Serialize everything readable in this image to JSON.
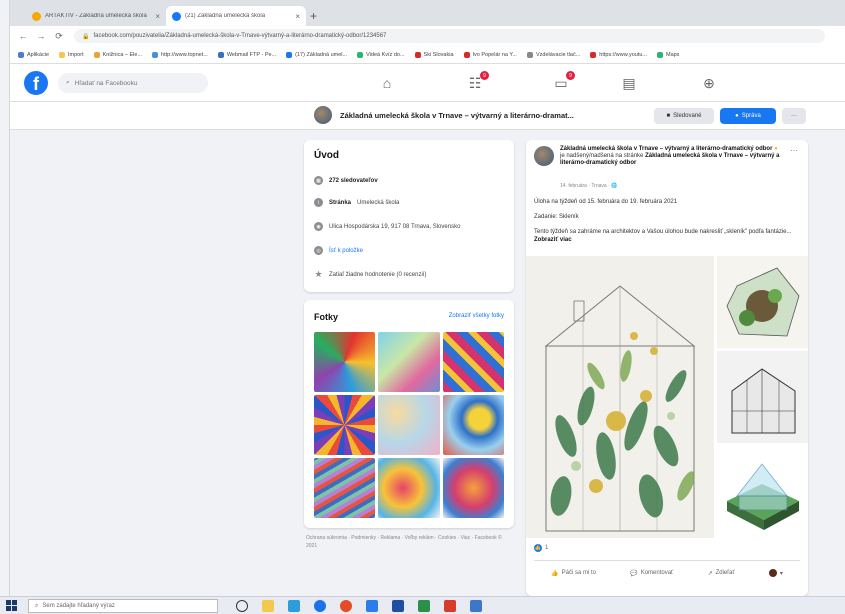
{
  "browser": {
    "tabs": [
      {
        "title": "ARTAKTÍV - Základná umelecká škola",
        "fav_color": "#f7a800"
      },
      {
        "title": "(21) Základná umelecká škola",
        "fav_color": "#1877f2"
      }
    ],
    "new_tab": "+",
    "url": "facebook.com/pouzivatelia/Základná-umelecká-škola-v-Trnave-výtvarný-a-literárno-dramatický-odbor/1234567",
    "bookmarks": [
      {
        "label": "Aplikácie",
        "color": "#4a7bd6"
      },
      {
        "label": "Import",
        "color": "#f2c94c"
      },
      {
        "label": "Knižnica – Ele...",
        "color": "#e8a33c"
      },
      {
        "label": "http://www.topnet...",
        "color": "#4a90d9"
      },
      {
        "label": "Webmail FTP - Pe...",
        "color": "#3b6fc4"
      },
      {
        "label": "(17) Základná umel...",
        "color": "#1877f2"
      },
      {
        "label": "Videá Kvíz do...",
        "color": "#2bb673"
      },
      {
        "label": "Ski Slovakia",
        "color": "#d62b2b"
      },
      {
        "label": "Ivo Popelár na Y...",
        "color": "#d62b2b"
      },
      {
        "label": "Vzdelávacie tlač...",
        "color": "#888888"
      },
      {
        "label": "https://www.youtu...",
        "color": "#d62b2b"
      },
      {
        "label": "Maps",
        "color": "#2bb673"
      }
    ]
  },
  "fb": {
    "logo": "f",
    "search_placeholder": "Hľadať na Facebooku",
    "badges": {
      "groups": "9",
      "gaming": "9"
    }
  },
  "page_header": {
    "name": "Základná umelecká škola v Trnave – výtvarný a literárno-dramat...",
    "follow": "Sledované",
    "message": "Správa",
    "more": "···"
  },
  "intro": {
    "title": "Úvod",
    "followers": "272 sledovateľov",
    "category_label": "Stránka",
    "category": "Umelecká škola",
    "address": "Ulica Hospodárska 19, 917 08 Trnava, Slovensko",
    "link": "Ísť k položke",
    "rating": "Zatiaľ žiadne hodnotenie (0 recenzií)"
  },
  "photos": {
    "title": "Fotky",
    "see_all": "Zobraziť všetky fotky"
  },
  "footer": "Ochrana súkromia · Podmienky · Reklama · Voľby reklám · Cookies · Viac · Facebook © 2021",
  "post": {
    "author": "Základná umelecká škola v Trnave – výtvarný a literárno-dramatický odbor",
    "feeling": "je nadšený/nadšená na stránke",
    "tag": "Základná umelecká škola v Trnave – výtvarný a literárno-dramatický odbor",
    "meta": "14. februára · Trnava · 🌐",
    "more": "···",
    "line1": "Úloha na týždeň od 15. februára do 19. februára 2021",
    "line2": "Zadanie: Skleník",
    "line3": "Tento týždeň sa zahráme na architektov a Vašou úlohou bude nakresliť „skleník\" podľa fantázie...",
    "see_more": "Zobraziť viac",
    "reactions": "1",
    "like": "Páči sa mi to",
    "comment": "Komentovať",
    "share": "Zdieľať"
  },
  "taskbar": {
    "search": "Sem zadajte hľadaný výraz"
  }
}
